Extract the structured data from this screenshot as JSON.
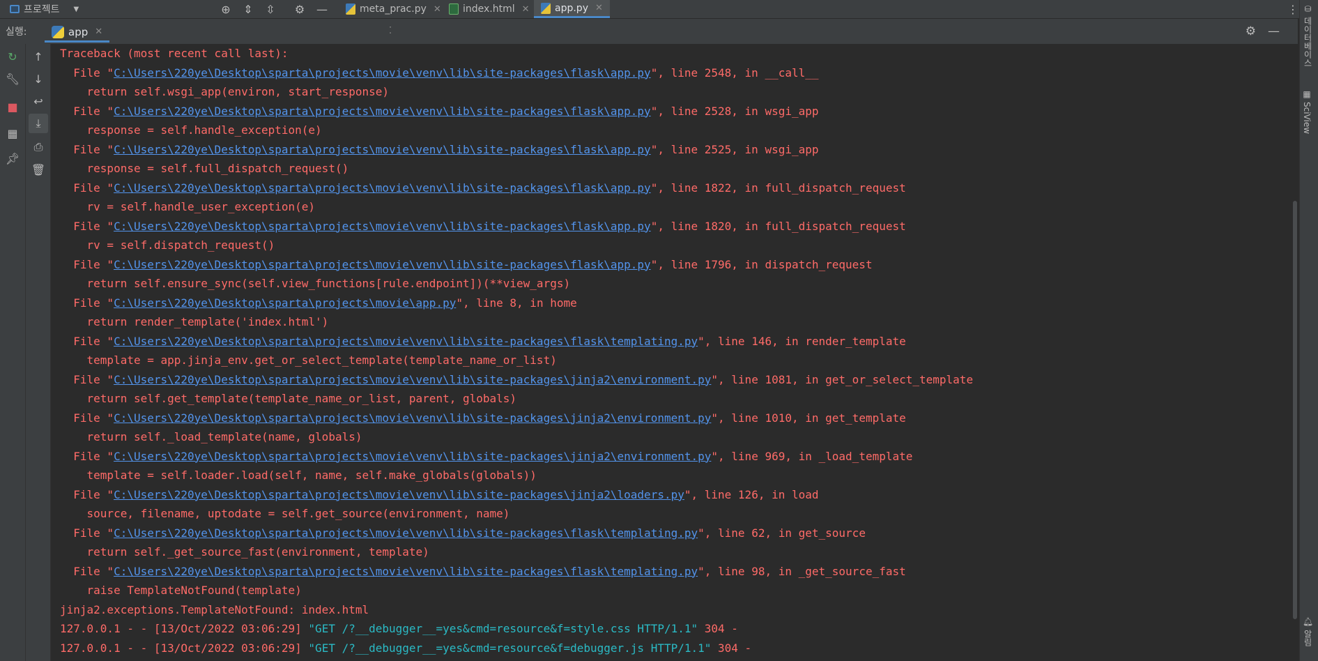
{
  "topbar": {
    "project_label": "프로젝트",
    "tabs": [
      {
        "label": "meta_prac.py",
        "type": "py"
      },
      {
        "label": "index.html",
        "type": "html"
      },
      {
        "label": "app.py",
        "type": "py"
      }
    ],
    "active_tab": "app.py"
  },
  "run": {
    "label": "실행:",
    "tab_label": "app"
  },
  "right_strip": {
    "database_label": "데이터베이스",
    "sciview_label": "SciView",
    "notifications_label": "알림"
  },
  "console": {
    "lines": [
      {
        "text": "Traceback (most recent call last):"
      },
      {
        "prefix": "  File \"",
        "link": "C:\\Users\\220ye\\Desktop\\sparta\\projects\\movie\\venv\\lib\\site-packages\\flask\\app.py",
        "suffix": "\", line 2548, in __call__"
      },
      {
        "text": "    return self.wsgi_app(environ, start_response)"
      },
      {
        "prefix": "  File \"",
        "link": "C:\\Users\\220ye\\Desktop\\sparta\\projects\\movie\\venv\\lib\\site-packages\\flask\\app.py",
        "suffix": "\", line 2528, in wsgi_app"
      },
      {
        "text": "    response = self.handle_exception(e)"
      },
      {
        "prefix": "  File \"",
        "link": "C:\\Users\\220ye\\Desktop\\sparta\\projects\\movie\\venv\\lib\\site-packages\\flask\\app.py",
        "suffix": "\", line 2525, in wsgi_app"
      },
      {
        "text": "    response = self.full_dispatch_request()"
      },
      {
        "prefix": "  File \"",
        "link": "C:\\Users\\220ye\\Desktop\\sparta\\projects\\movie\\venv\\lib\\site-packages\\flask\\app.py",
        "suffix": "\", line 1822, in full_dispatch_request"
      },
      {
        "text": "    rv = self.handle_user_exception(e)"
      },
      {
        "prefix": "  File \"",
        "link": "C:\\Users\\220ye\\Desktop\\sparta\\projects\\movie\\venv\\lib\\site-packages\\flask\\app.py",
        "suffix": "\", line 1820, in full_dispatch_request"
      },
      {
        "text": "    rv = self.dispatch_request()"
      },
      {
        "prefix": "  File \"",
        "link": "C:\\Users\\220ye\\Desktop\\sparta\\projects\\movie\\venv\\lib\\site-packages\\flask\\app.py",
        "suffix": "\", line 1796, in dispatch_request"
      },
      {
        "text": "    return self.ensure_sync(self.view_functions[rule.endpoint])(**view_args)"
      },
      {
        "prefix": "  File \"",
        "link": "C:\\Users\\220ye\\Desktop\\sparta\\projects\\movie\\app.py",
        "suffix": "\", line 8, in home"
      },
      {
        "text": "    return render_template('index.html')"
      },
      {
        "prefix": "  File \"",
        "link": "C:\\Users\\220ye\\Desktop\\sparta\\projects\\movie\\venv\\lib\\site-packages\\flask\\templating.py",
        "suffix": "\", line 146, in render_template"
      },
      {
        "text": "    template = app.jinja_env.get_or_select_template(template_name_or_list)"
      },
      {
        "prefix": "  File \"",
        "link": "C:\\Users\\220ye\\Desktop\\sparta\\projects\\movie\\venv\\lib\\site-packages\\jinja2\\environment.py",
        "suffix": "\", line 1081, in get_or_select_template"
      },
      {
        "text": "    return self.get_template(template_name_or_list, parent, globals)"
      },
      {
        "prefix": "  File \"",
        "link": "C:\\Users\\220ye\\Desktop\\sparta\\projects\\movie\\venv\\lib\\site-packages\\jinja2\\environment.py",
        "suffix": "\", line 1010, in get_template"
      },
      {
        "text": "    return self._load_template(name, globals)"
      },
      {
        "prefix": "  File \"",
        "link": "C:\\Users\\220ye\\Desktop\\sparta\\projects\\movie\\venv\\lib\\site-packages\\jinja2\\environment.py",
        "suffix": "\", line 969, in _load_template"
      },
      {
        "text": "    template = self.loader.load(self, name, self.make_globals(globals))"
      },
      {
        "prefix": "  File \"",
        "link": "C:\\Users\\220ye\\Desktop\\sparta\\projects\\movie\\venv\\lib\\site-packages\\jinja2\\loaders.py",
        "suffix": "\", line 126, in load"
      },
      {
        "text": "    source, filename, uptodate = self.get_source(environment, name)"
      },
      {
        "prefix": "  File \"",
        "link": "C:\\Users\\220ye\\Desktop\\sparta\\projects\\movie\\venv\\lib\\site-packages\\flask\\templating.py",
        "suffix": "\", line 62, in get_source"
      },
      {
        "text": "    return self._get_source_fast(environment, template)"
      },
      {
        "prefix": "  File \"",
        "link": "C:\\Users\\220ye\\Desktop\\sparta\\projects\\movie\\venv\\lib\\site-packages\\flask\\templating.py",
        "suffix": "\", line 98, in _get_source_fast"
      },
      {
        "text": "    raise TemplateNotFound(template)"
      },
      {
        "text": "jinja2.exceptions.TemplateNotFound: index.html"
      },
      {
        "req_prefix": "127.0.0.1 - - [13/Oct/2022 03:06:29] ",
        "req": "\"GET /?__debugger__=yes&cmd=resource&f=style.css HTTP/1.1\"",
        "req_suffix": " 304 -"
      },
      {
        "req_prefix": "127.0.0.1 - - [13/Oct/2022 03:06:29] ",
        "req": "\"GET /?__debugger__=yes&cmd=resource&f=debugger.js HTTP/1.1\"",
        "req_suffix": " 304 -"
      }
    ]
  }
}
